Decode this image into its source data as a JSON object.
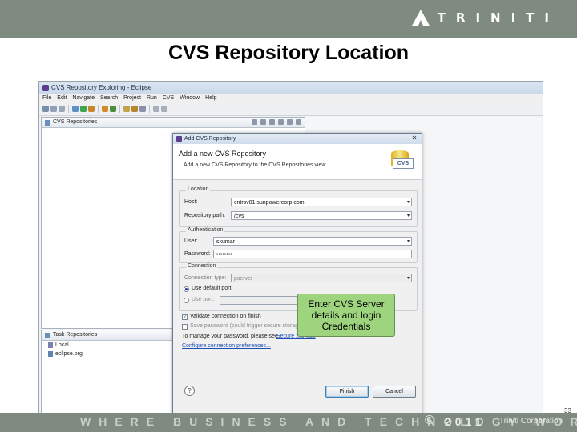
{
  "slide": {
    "title": "CVS Repository Location",
    "logo_text": "TRINITI",
    "tagline": "WHERE BUSINESS AND TECHNOLOGY WORK",
    "copyright_symbol": "©",
    "copyright_year": "2011",
    "company": "Triniti Corporation",
    "page_number": "33"
  },
  "eclipse": {
    "window_title": "CVS Repository Exploring - Eclipse",
    "menu": [
      "File",
      "Edit",
      "Navigate",
      "Search",
      "Project",
      "Run",
      "CVS",
      "Window",
      "Help"
    ],
    "repo_view_tab": "CVS Repositories",
    "task_view_tab": "Task Repositories",
    "task_items": [
      "Local",
      "eclipse.org"
    ]
  },
  "dialog": {
    "window_title": "Add CVS Repository",
    "heading": "Add a new CVS Repository",
    "subtitle": "Add a new CVS Repository to the CVS Repositories view",
    "location_group": "Location",
    "host_label": "Host:",
    "host_value": "cntrsv01.sunpowercorp.com",
    "path_label": "Repository path:",
    "path_value": "/cvs",
    "auth_group": "Authentication",
    "user_label": "User:",
    "user_value": "skumar",
    "password_label": "Password:",
    "password_value": "••••••••",
    "connection_group": "Connection",
    "conn_type_label": "Connection type:",
    "conn_type_value": "pserver",
    "default_port_label": "Use default port",
    "use_port_label": "Use port:",
    "validate_label": "Validate connection on finish",
    "save_password_label": "Save password (could trigger secure storage login)",
    "manage_text": "To manage your password, please see",
    "secure_storage_link": "Secure Storage",
    "configure_link": "Configure connection preferences...",
    "help_label": "?",
    "finish_label": "Finish",
    "cancel_label": "Cancel"
  },
  "callout": "Enter CVS Server details and login Credentials"
}
